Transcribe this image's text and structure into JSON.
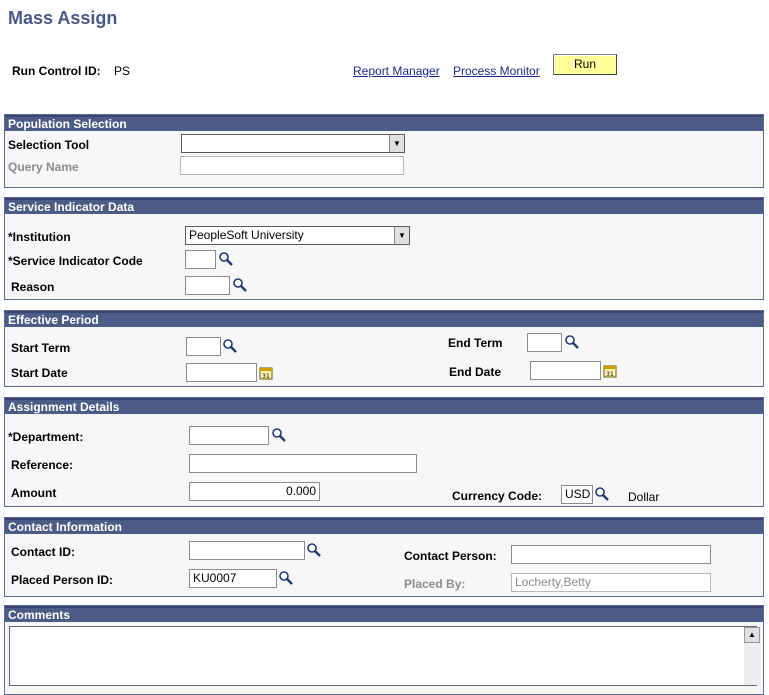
{
  "page": {
    "title": "Mass Assign"
  },
  "header": {
    "run_control_label": "Run Control ID:",
    "run_control_value": "PS",
    "report_manager": "Report Manager",
    "process_monitor": "Process Monitor",
    "run_label": "Run"
  },
  "population": {
    "title": "Population Selection",
    "selection_tool_label": "Selection Tool",
    "selection_tool_value": "",
    "query_name_label": "Query Name",
    "query_name_value": ""
  },
  "service": {
    "title": "Service Indicator Data",
    "institution_label": "*Institution",
    "institution_value": "PeopleSoft University",
    "code_label": "*Service Indicator Code",
    "code_value": "",
    "reason_label": "Reason",
    "reason_value": ""
  },
  "effective": {
    "title": "Effective Period",
    "start_term_label": "Start Term",
    "start_term_value": "",
    "end_term_label": "End Term",
    "end_term_value": "",
    "start_date_label": "Start Date",
    "start_date_value": "",
    "end_date_label": "End Date",
    "end_date_value": ""
  },
  "assignment": {
    "title": "Assignment Details",
    "department_label": "*Department:",
    "department_value": "",
    "reference_label": "Reference:",
    "reference_value": "",
    "amount_label": "Amount",
    "amount_value": "0.000",
    "currency_label": "Currency Code:",
    "currency_value": "USD",
    "currency_desc": "Dollar"
  },
  "contact": {
    "title": "Contact Information",
    "contact_id_label": "Contact ID:",
    "contact_id_value": "",
    "contact_person_label": "Contact Person:",
    "contact_person_value": "",
    "placed_person_label": "Placed Person ID:",
    "placed_person_value": "KU0007",
    "placed_by_label": "Placed By:",
    "placed_by_value": "Locherty,Betty"
  },
  "comments": {
    "title": "Comments",
    "value": ""
  },
  "icons": {
    "lookup": "magnifier-lookup-icon",
    "calendar": "calendar-icon",
    "dropdown": "dropdown-arrow-icon"
  }
}
